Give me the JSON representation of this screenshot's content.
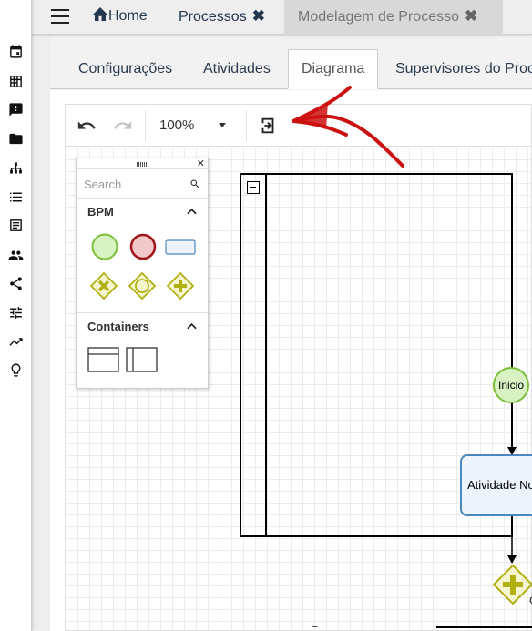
{
  "header": {
    "tabs": [
      {
        "label": "Home",
        "icon": "home-icon"
      },
      {
        "label": "Processos",
        "closable": true
      },
      {
        "label": "Modelagem de Processo",
        "closable": true,
        "active": true
      }
    ],
    "close_glyph": "✖"
  },
  "rail": {
    "icons": [
      "calendar-icon",
      "dashboard-icon",
      "feedback-icon",
      "folder-icon",
      "sitemap-icon",
      "list-icon",
      "table-icon",
      "people-icon",
      "share-icon",
      "tune-icon",
      "trending-up-icon",
      "lightbulb-icon"
    ]
  },
  "subtabs": [
    {
      "label": "Configurações"
    },
    {
      "label": "Atividades"
    },
    {
      "label": "Diagrama",
      "active": true
    },
    {
      "label": "Supervisores do Proc"
    }
  ],
  "toolbar": {
    "zoom": "100%",
    "buttons": [
      "undo-icon",
      "redo-icon",
      "zoom-dropdown",
      "export-icon"
    ]
  },
  "palette": {
    "search_placeholder": "Search",
    "sections": [
      {
        "title": "BPM",
        "expanded": true,
        "shapes": [
          "start-event",
          "end-event",
          "task",
          "exclusive-gateway",
          "event-gateway",
          "parallel-gateway"
        ]
      },
      {
        "title": "Containers",
        "expanded": true,
        "shapes": [
          "pool-horizontal",
          "pool-vertical"
        ]
      }
    ]
  },
  "diagram": {
    "start_event_label": "Inicio",
    "task_label": "Atividade No",
    "gateway_label_fragment": "C",
    "colors": {
      "start_fill": "#d9f2c4",
      "start_stroke": "#7cbf3a",
      "task_fill": "#eef4fb",
      "task_stroke": "#4b88c0",
      "gateway_fill": "#f5f5d0",
      "gateway_stroke": "#b0b012",
      "end_fill": "#f2c9c9",
      "end_stroke": "#a31515"
    }
  },
  "annotation": {
    "arrow_color": "#cc1111"
  }
}
